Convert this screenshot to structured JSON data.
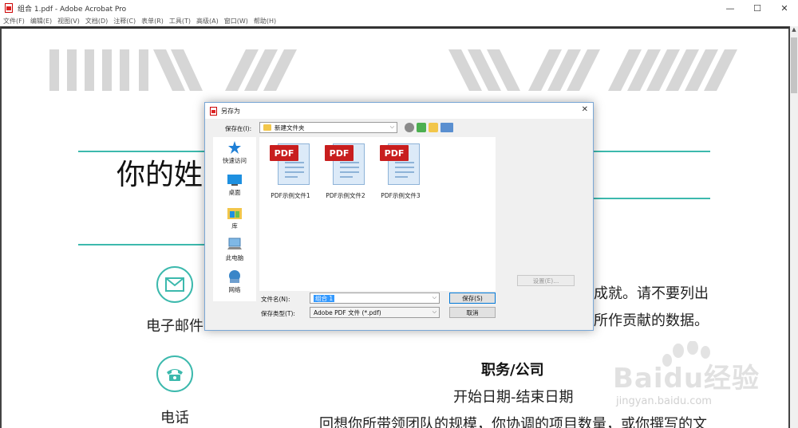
{
  "window": {
    "title": "组合 1.pdf - Adobe Acrobat Pro",
    "controls": [
      "—",
      "☐",
      "✕"
    ]
  },
  "menubar": {
    "items": [
      "文件(F)",
      "编辑(E)",
      "视图(V)",
      "文档(D)",
      "注释(C)",
      "表单(R)",
      "工具(T)",
      "高级(A)",
      "窗口(W)",
      "帮助(H)"
    ]
  },
  "document": {
    "name_heading": "你的姓",
    "contacts": {
      "email_label": "电子邮件",
      "phone_label": "电话"
    },
    "right_text": {
      "line1": "成就。请不要列出",
      "line2": "所作贡献的数据。"
    },
    "job": {
      "title": "职务/公司",
      "dates": "开始日期-结束日期",
      "desc": "回想你所带领团队的规模，你协调的项目数量，或你撰写的文"
    },
    "accent_color": "#3cb9ad"
  },
  "watermark": {
    "brand": "Baidu经验",
    "url": "jingyan.baidu.com"
  },
  "dialog": {
    "title": "另存为",
    "save_in_label": "保存在(I):",
    "save_in_value": "新建文件夹",
    "places": [
      {
        "label": "快速访问",
        "icon": "star-icon"
      },
      {
        "label": "桌面",
        "icon": "desktop-icon"
      },
      {
        "label": "库",
        "icon": "library-icon"
      },
      {
        "label": "此电脑",
        "icon": "computer-icon"
      },
      {
        "label": "网络",
        "icon": "network-icon"
      }
    ],
    "files": [
      {
        "name": "PDF示例文件1",
        "badge": "PDF"
      },
      {
        "name": "PDF示例文件2",
        "badge": "PDF"
      },
      {
        "name": "PDF示例文件3",
        "badge": "PDF"
      }
    ],
    "settings_button": "设置(E)...",
    "filename_label": "文件名(N):",
    "filename_value": "组合 1",
    "filetype_label": "保存类型(T):",
    "filetype_value": "Adobe PDF 文件 (*.pdf)",
    "save_button": "保存(S)",
    "cancel_button": "取消"
  }
}
